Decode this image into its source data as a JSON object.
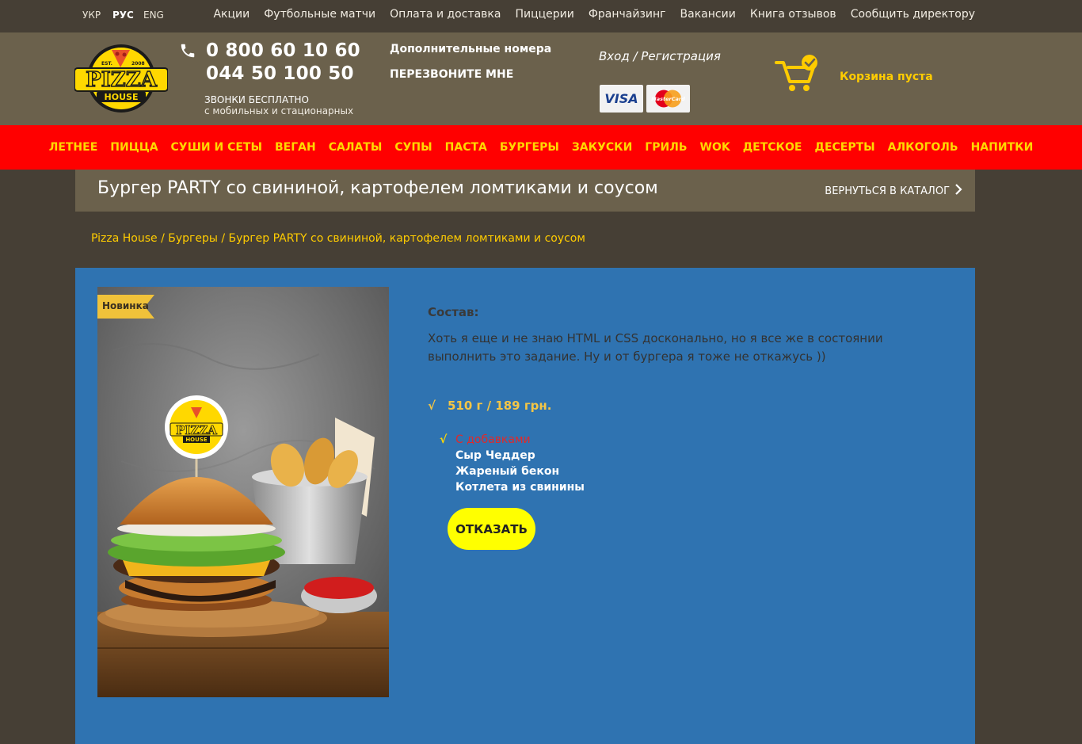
{
  "languages": [
    {
      "label": "УКР",
      "active": false
    },
    {
      "label": "РУС",
      "active": true
    },
    {
      "label": "ENG",
      "active": false
    }
  ],
  "topnav": [
    "Акции",
    "Футбольные матчи",
    "Оплата и доставка",
    "Пиццерии",
    "Франчайзинг",
    "Вакансии",
    "Книга отзывов",
    "Сообщить директору"
  ],
  "header": {
    "logo_text": "PIZZA",
    "logo_sub": "HOUSE",
    "logo_est": "EST.",
    "logo_year": "2008",
    "phone1": "0 800 60 10 60",
    "phone2": "044 50 100 50",
    "free_line1": "ЗВОНКИ БЕСПЛАТНО",
    "free_line2": "с мобильных и стационарных",
    "extra_numbers": "Дополнительные номера",
    "callback": "ПЕРЕЗВОНИТЕ МНЕ",
    "login": "Вход / Регистрация",
    "visa": "VISA",
    "mastercard": "MasterCard",
    "cart": "Корзина пуста"
  },
  "menu": [
    "ЛЕТНЕЕ",
    "ПИЦЦА",
    "СУШИ И СЕТЫ",
    "ВЕГАН",
    "САЛАТЫ",
    "СУПЫ",
    "ПАСТА",
    "БУРГЕРЫ",
    "ЗАКУСКИ",
    "ГРИЛЬ",
    "WOK",
    "ДЕТСКОЕ",
    "ДЕСЕРТЫ",
    "АЛКОГОЛЬ",
    "НАПИТКИ"
  ],
  "title": "Бургер PARTY со свининой, картофелем ломтиками и соусом",
  "back_label": "ВЕРНУТЬСЯ В КАТАЛОГ",
  "breadcrumb": "Pizza House / Бургеры / Бургер PARTY со свининой, картофелем ломтиками и соусом",
  "product": {
    "badge": "Новинка",
    "composition_title": "Состав:",
    "composition_text": "Хоть я еще и не знаю HTML и CSS досконально, но я все же в состоянии выполнить это задание. Ну и от бургера я тоже не откажусь ))",
    "check": "√",
    "price": "510 г / 189 грн.",
    "additions_title": "С добавками",
    "additions": [
      "Сыр Чеддер",
      "Жареный бекон",
      "Котлета из свинины"
    ],
    "refuse_button": "ОТКАЗАТЬ"
  },
  "colors": {
    "topbar": "#463f35",
    "header": "#6b614c",
    "menu": "#ff0000",
    "menu_text": "#ffd800",
    "panel": "#2f73b1",
    "accent": "#ffcc00"
  }
}
